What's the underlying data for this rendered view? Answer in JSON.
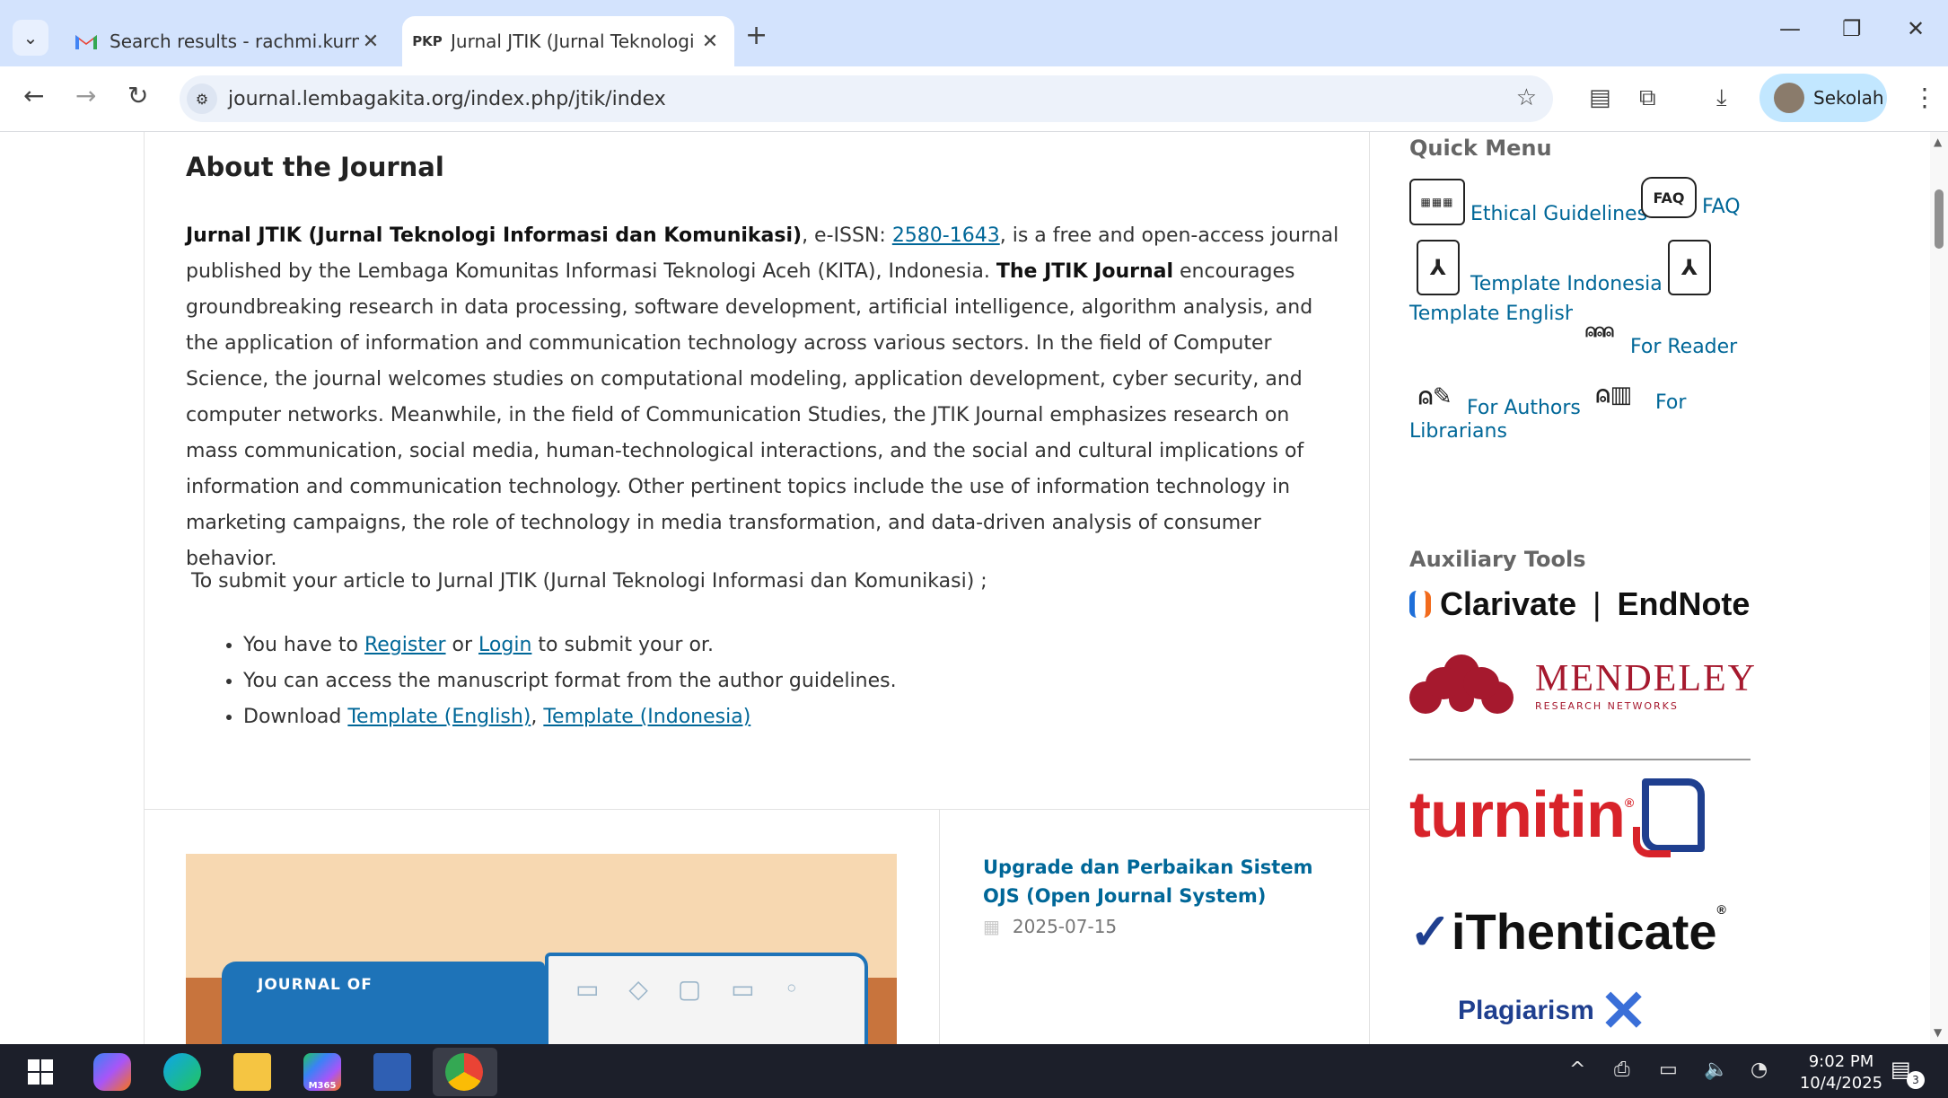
{
  "browser": {
    "tabs": [
      {
        "title": "Search results - rachmi.kurnia@",
        "favicon": "gmail-icon",
        "close": "✕"
      },
      {
        "title": "Jurnal JTIK (Jurnal Teknologi Inf",
        "favicon_text": "PKP",
        "close": "✕"
      }
    ],
    "new_tab": "+",
    "url": "journal.lembagakita.org/index.php/jtik/index",
    "profile_name": "Sekolah",
    "window_controls": {
      "minimize": "—",
      "restore": "❐",
      "close": "✕"
    }
  },
  "about": {
    "title": "About the Journal",
    "journal_name": "Jurnal JTIK (Jurnal Teknologi Informasi dan Komunikasi)",
    "issn_prefix": ", e-ISSN: ",
    "issn": "2580-1643",
    "text_1": ", is a free and open-access journal published by the Lembaga Komunitas Informasi Teknologi Aceh (KITA), Indonesia. ",
    "jtik_bold": "The JTIK Journal",
    "text_2": " encourages groundbreaking research in data processing, software development, artificial intelligence, algorithm analysis, and the application of information and communication technology across various sectors. In the field of Computer Science, the journal welcomes studies on computational modeling, application development, cyber security, and computer networks. Meanwhile, in the field of Communication Studies, the JTIK Journal emphasizes research on mass communication, social media, human-technological interactions, and the social and cultural implications of information and communication technology. Other pertinent topics include the use of information technology in marketing campaigns, the role of technology in media transformation, and data-driven analysis of consumer behavior.",
    "submit_intro": "To submit your article to Jurnal JTIK (Jurnal Teknologi Informasi dan Komunikasi) ;",
    "bullet_1_a": "You have to ",
    "register": "Register",
    "bullet_1_or": " or ",
    "login": "Login",
    "bullet_1_b": " to submit your or.",
    "bullet_2": "You can access the manuscript format from the author guidelines.",
    "bullet_3_a": "Download ",
    "template_en": "Template (English)",
    "comma": ", ",
    "template_id": "Template (Indonesia)"
  },
  "announcement": {
    "cover_title": "JOURNAL OF",
    "title": "Upgrade dan Perbaikan Sistem OJS (Open Journal System)",
    "date": "2025-07-15"
  },
  "sidebar": {
    "quick_menu_title": "Quick Menu",
    "quick_menu": {
      "ethical": "Ethical Guidelines",
      "faq_icon_text": "FAQ",
      "faq": "FAQ",
      "template_id": "Template Indonesia",
      "template_en": "Template English",
      "for_reader": "For Reader",
      "for_authors": "For Authors",
      "for_librarians": "For Librarians"
    },
    "aux_title": "Auxiliary Tools",
    "tools": {
      "clarivate": "Clarivate",
      "endnote": "EndNote",
      "separator": "|",
      "mendeley": "MENDELEY",
      "mendeley_sub": "RESEARCH NETWORKS",
      "turnitin": "turnitin",
      "ithenticate": "iThenticate",
      "plagiarism": "Plagiarism"
    }
  },
  "taskbar": {
    "m365": "M365",
    "time": "9:02 PM",
    "date": "10/4/2025",
    "notifications": "3"
  },
  "colors": {
    "link": "#006798",
    "tabbar": "#d3e3fd",
    "taskbar": "#1c1f2a"
  }
}
